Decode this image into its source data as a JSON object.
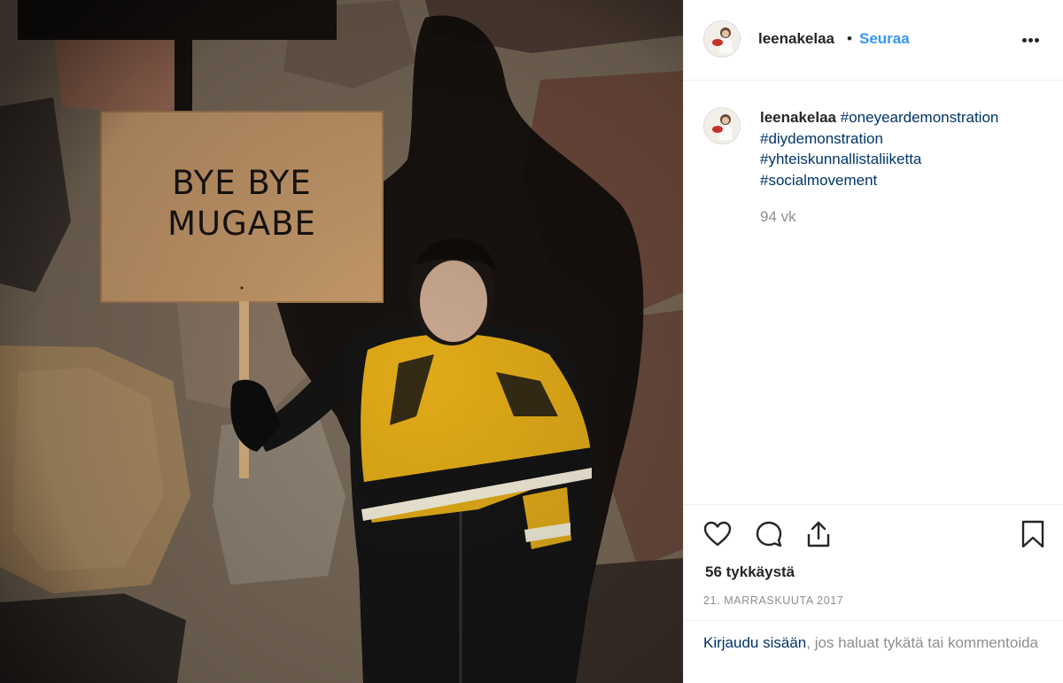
{
  "photo": {
    "sign_line1": "BYE BYE",
    "sign_line2": "MUGABE"
  },
  "header": {
    "username": "leenakelaa",
    "separator": "•",
    "follow_label": "Seuraa"
  },
  "caption": {
    "username": "leenakelaa",
    "hashtags": [
      "#oneyeardemonstration",
      "#diydemonstration",
      "#yhteiskunnallistaliiketta",
      "#socialmovement"
    ],
    "age": "94 vk"
  },
  "actions": {
    "icons": [
      "heart-icon",
      "comment-icon",
      "share-icon",
      "bookmark-icon"
    ]
  },
  "likes_text": "56 tykkäystä",
  "date_text": "21. MARRASKUUTA 2017",
  "login": {
    "link_text": "Kirjaudu sisään",
    "rest_text": ", jos haluat tykätä tai kommentoida"
  },
  "colors": {
    "link_blue": "#3897f0",
    "hashtag_blue": "#003569",
    "muted_gray": "#8e8e8e",
    "text_dark": "#262626"
  }
}
